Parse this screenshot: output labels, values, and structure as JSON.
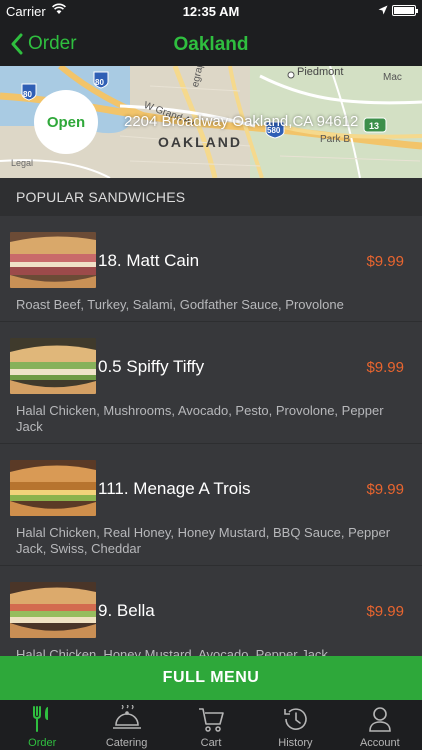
{
  "status_bar": {
    "carrier": "Carrier",
    "time": "12:35 AM"
  },
  "nav": {
    "back_label": "Order",
    "title": "Oakland"
  },
  "store": {
    "status": "Open",
    "address": "2204 Broadway Oakland,CA 94612"
  },
  "map": {
    "labels": {
      "piedmont": "Piedmont",
      "oakland": "OAKLAND",
      "legal": "Legal",
      "grand": "W Grand Av",
      "mac": "Mac",
      "park": "Park B",
      "telegraph": "egraph Ave",
      "shield_80a": "80",
      "shield_80b": "80",
      "shield_580": "580",
      "shield_13": "13"
    }
  },
  "section": {
    "title": "POPULAR SANDWICHES"
  },
  "items": [
    {
      "name": "18. Matt Cain",
      "price": "$9.99",
      "description": "Roast Beef, Turkey, Salami, Godfather Sauce, Provolone"
    },
    {
      "name": "0.5 Spiffy Tiffy",
      "price": "$9.99",
      "description": "Halal Chicken, Mushrooms, Avocado, Pesto, Provolone, Pepper Jack"
    },
    {
      "name": "111. Menage A Trois",
      "price": "$9.99",
      "description": "Halal Chicken, Real Honey, Honey Mustard, BBQ Sauce, Pepper Jack, Swiss, Cheddar"
    },
    {
      "name": "9. Bella",
      "price": "$9.99",
      "description": "Halal Chicken, Honey Mustard, Avocado, Pepper Jack"
    }
  ],
  "full_menu_label": "FULL MENU",
  "tabs": [
    {
      "label": "Order",
      "icon": "fork-knife-icon",
      "active": true
    },
    {
      "label": "Catering",
      "icon": "cloche-icon",
      "active": false
    },
    {
      "label": "Cart",
      "icon": "cart-icon",
      "active": false
    },
    {
      "label": "History",
      "icon": "history-icon",
      "active": false
    },
    {
      "label": "Account",
      "icon": "person-icon",
      "active": false
    }
  ],
  "colors": {
    "accent": "#2fbf3f",
    "price": "#e9652f",
    "button": "#2ea83a",
    "background": "#37383b"
  }
}
